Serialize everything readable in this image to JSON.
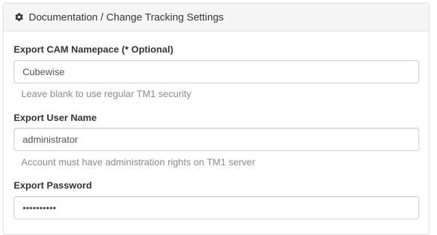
{
  "panel": {
    "heading": "Documentation / Change Tracking Settings",
    "heading_icon": "gear-icon"
  },
  "fields": {
    "cam_namespace": {
      "label": "Export CAM Namepace (* Optional)",
      "value": "Cubewise",
      "help": "Leave blank to use regular TM1 security"
    },
    "user_name": {
      "label": "Export User Name",
      "value": "administrator",
      "help": "Account must have administration rights on TM1 server"
    },
    "password": {
      "label": "Export Password",
      "value": "aaaaaaaaaa"
    }
  }
}
